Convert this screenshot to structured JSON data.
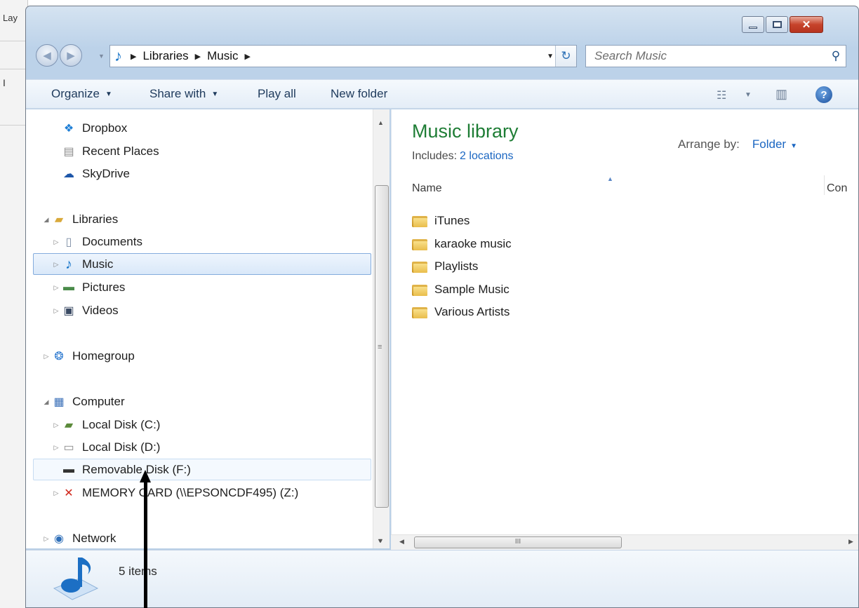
{
  "background_app": {
    "tab_label": "Lay",
    "glyph": "I"
  },
  "window": {
    "controls": {
      "minimize": "▭",
      "maximize": "□",
      "close": "✕"
    },
    "address_bar": {
      "crumbs": [
        "Libraries",
        "Music"
      ],
      "separator": "▶",
      "dropdown": "▼",
      "refresh": "↻"
    },
    "search": {
      "placeholder": "Search Music",
      "icon": "search-icon"
    },
    "command_bar": {
      "organize": "Organize",
      "share_with": "Share with",
      "play_all": "Play all",
      "new_folder": "New folder",
      "dropdown_arrow": "▼",
      "help": "?"
    },
    "navigation": {
      "favorites": [
        "Dropbox",
        "Recent Places",
        "SkyDrive"
      ],
      "libraries": {
        "label": "Libraries",
        "items": [
          "Documents",
          "Music",
          "Pictures",
          "Videos"
        ]
      },
      "homegroup": "Homegroup",
      "computer": {
        "label": "Computer",
        "items": [
          "Local Disk (C:)",
          "Local Disk (D:)",
          "Removable Disk (F:)",
          "MEMORY CARD (\\\\EPSONCDF495) (Z:)"
        ]
      },
      "network": "Network",
      "expanded_glyph": "◢",
      "collapsed_glyph": "▷",
      "selected": "Music",
      "hovered": "Removable Disk (F:)"
    },
    "main": {
      "title": "Music library",
      "includes_label": "Includes:",
      "includes_link": "2 locations",
      "arrange_label": "Arrange by:",
      "arrange_value": "Folder",
      "columns": [
        "Name",
        "Con"
      ],
      "files": [
        "iTunes",
        "karaoke music",
        "Playlists",
        "Sample Music",
        "Various Artists"
      ]
    },
    "scroll": {
      "up": "▲",
      "down": "▼",
      "left": "◀",
      "right": "▶",
      "grip_v": "≡",
      "grip_h": "III"
    },
    "details": {
      "count": "5 items"
    }
  },
  "colors": {
    "title_green": "#1e7d35",
    "link_blue": "#1a66c2",
    "selection_border": "#84acdd"
  }
}
